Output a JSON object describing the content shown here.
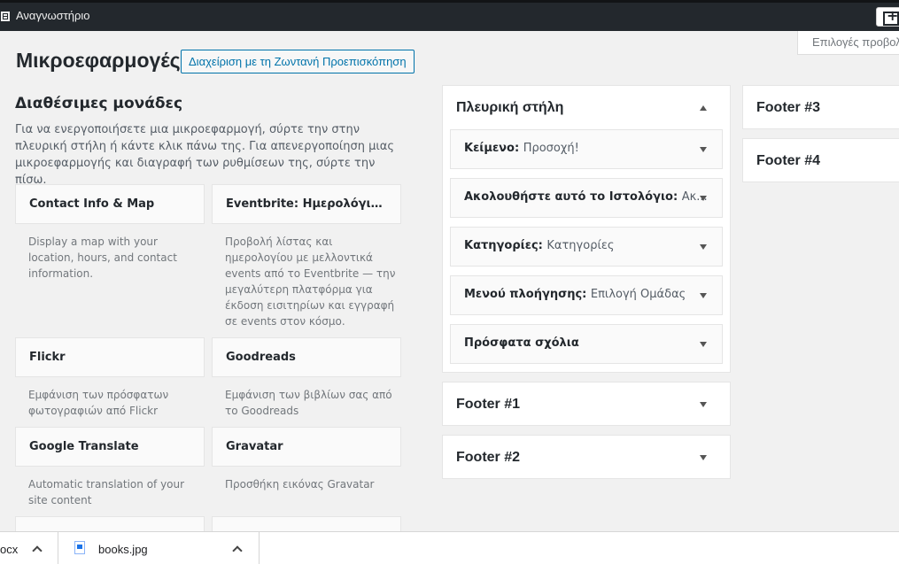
{
  "adminbar": {
    "site_name": "Αναγνωστήριο"
  },
  "screen_options": "Επιλογές προβολής",
  "page": {
    "title": "Μικροεφαρμογές",
    "live_preview_button": "Διαχείριση με τη Ζωντανή Προεπισκόπηση"
  },
  "available": {
    "title": "Διαθέσιμες μονάδες",
    "description": "Για να ενεργοποιήσετε μια μικροεφαρμογή, σύρτε την στην πλευρική στήλη ή κάντε κλικ πάνω της. Για απενεργοποίηση μιας μικροεφαρμογής και διαγραφή των ρυθμίσεων της, σύρτε την πίσω.",
    "widgets": [
      {
        "name": "Contact Info & Map",
        "desc": "Display a map with your location, hours, and contact information."
      },
      {
        "name": "Eventbrite: Ημερολόγιο/λίστα",
        "desc": "Προβολή λίστας και ημερολογίου με μελλοντικά events από το Eventbrite — την μεγαλύτερη πλατφόρμα για έκδοση εισιτηρίων και εγγραφή σε events στον κόσμο."
      },
      {
        "name": "Flickr",
        "desc": "Εμφάνιση των πρόσφατων φωτογραφιών από Flickr"
      },
      {
        "name": "Goodreads",
        "desc": "Εμφάνιση των βιβλίων σας από το Goodreads"
      },
      {
        "name": "Google Translate",
        "desc": "Automatic translation of your site content"
      },
      {
        "name": "Gravatar",
        "desc": "Προσθήκη εικόνας Gravatar"
      }
    ]
  },
  "sidebars": {
    "main": {
      "title": "Πλευρική στήλη",
      "widgets": [
        {
          "name": "Κείμενο",
          "title": "Προσοχή!"
        },
        {
          "name": "Ακολουθήστε αυτό το Ιστολόγιο",
          "title": "Ακ..."
        },
        {
          "name": "Κατηγορίες",
          "title": "Κατηγορίες"
        },
        {
          "name": "Μενού πλοήγησης",
          "title": "Επιλογή Ομάδας"
        },
        {
          "name": "Πρόσφατα σχόλια",
          "title": ""
        }
      ]
    },
    "footer1": {
      "title": "Footer #1"
    },
    "footer2": {
      "title": "Footer #2"
    },
    "footer3": {
      "title": "Footer #3"
    },
    "footer4": {
      "title": "Footer #4"
    }
  },
  "downloads": [
    {
      "name": "ocx"
    },
    {
      "name": "books.jpg"
    }
  ]
}
